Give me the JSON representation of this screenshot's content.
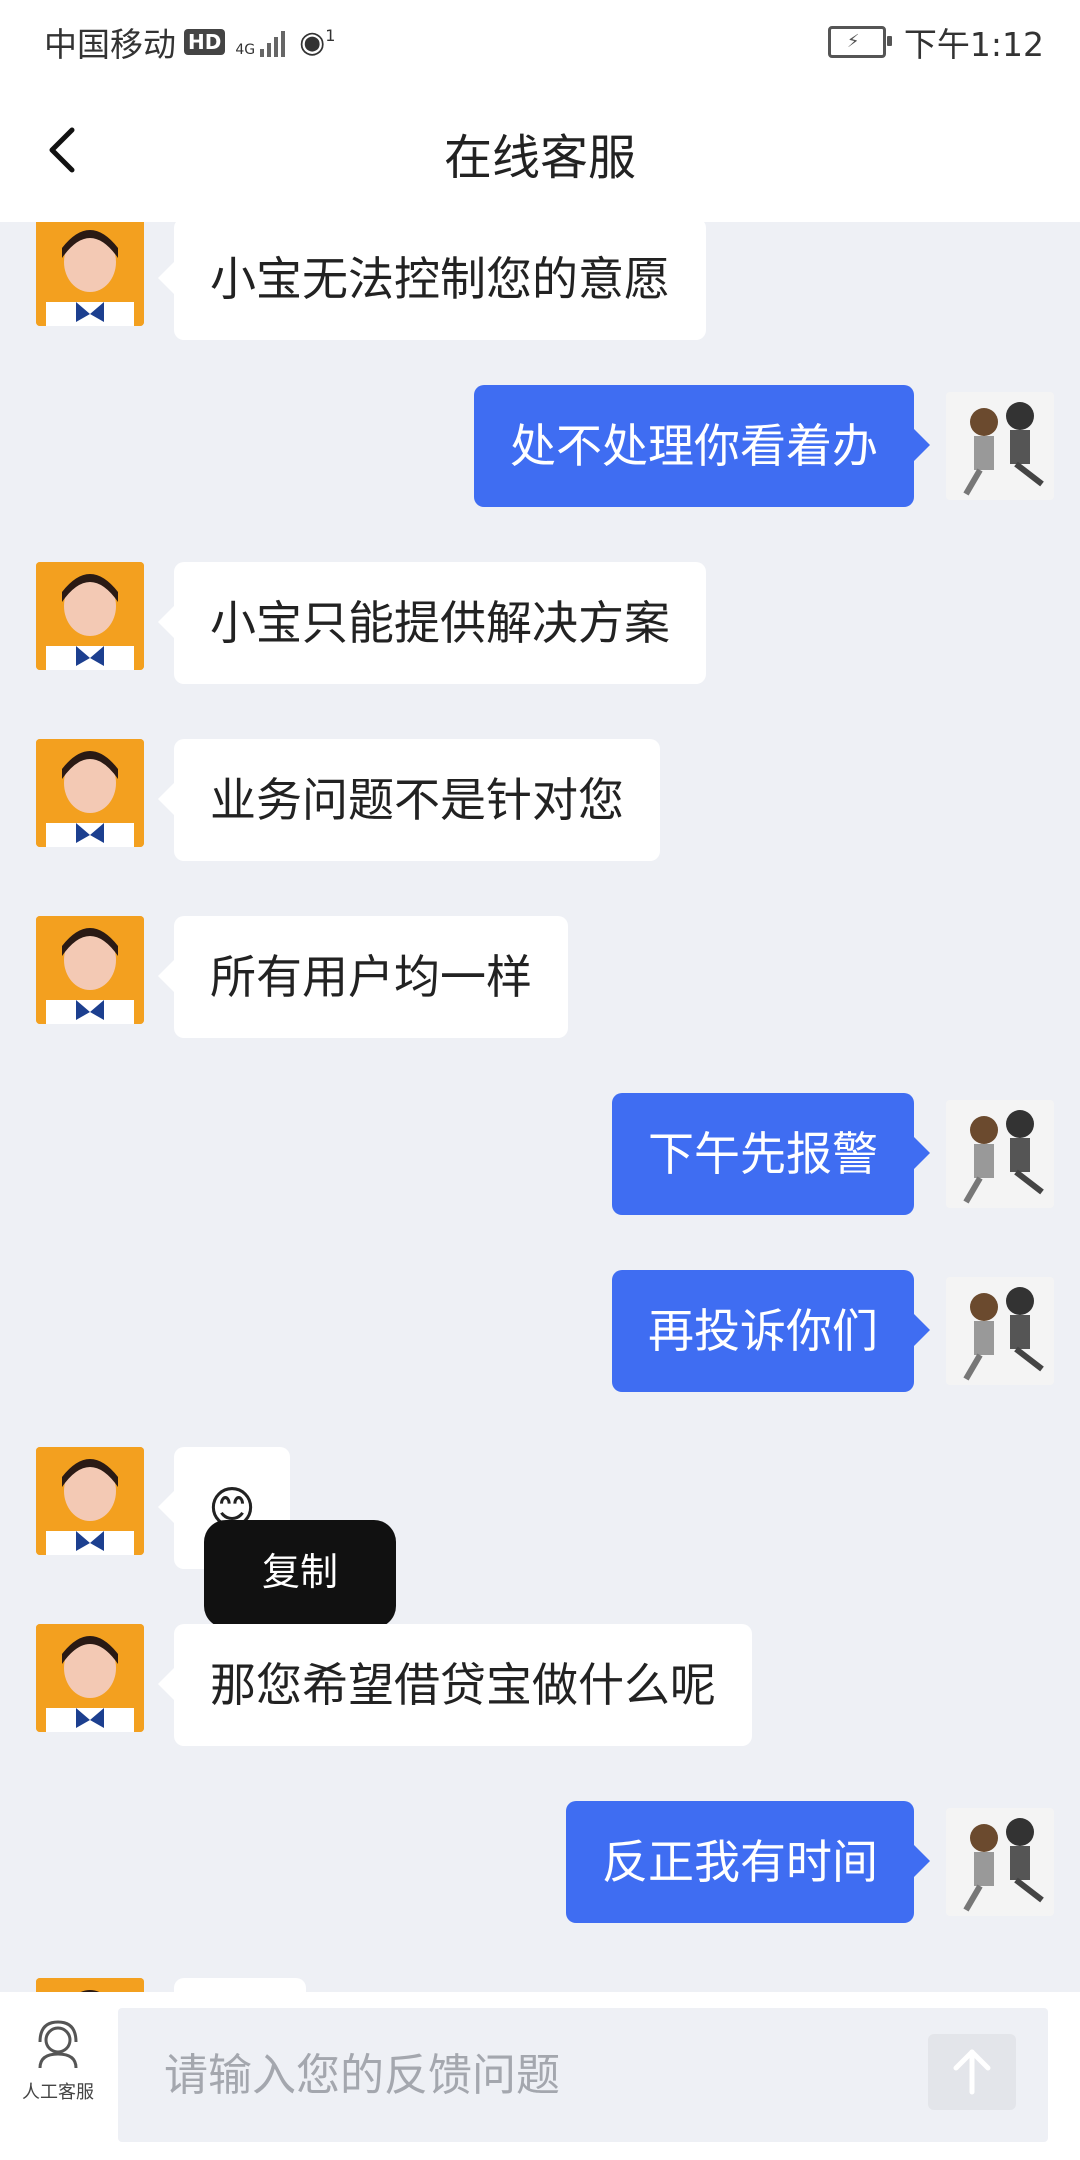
{
  "status_bar": {
    "carrier": "中国移动",
    "hd": "HD",
    "network": "4G",
    "hotspot_count": "1",
    "time": "下午1:12"
  },
  "header": {
    "title": "在线客服"
  },
  "messages": [
    {
      "side": "left",
      "text": "小宝无法控制您的意愿"
    },
    {
      "side": "right",
      "text": "处不处理你看着办"
    },
    {
      "side": "left",
      "text": "小宝只能提供解决方案"
    },
    {
      "side": "left",
      "text": "业务问题不是针对您"
    },
    {
      "side": "left",
      "text": "所有用户均一样"
    },
    {
      "side": "right",
      "text": "下午先报警"
    },
    {
      "side": "right",
      "text": "再投诉你们"
    },
    {
      "side": "left",
      "text": "😊"
    },
    {
      "side": "left",
      "text": "那您希望借贷宝做什么呢"
    },
    {
      "side": "right",
      "text": "反正我有时间"
    }
  ],
  "context_menu": {
    "copy": "复制"
  },
  "bottom_bar": {
    "agent_label": "人工客服",
    "input_placeholder": "请输入您的反馈问题"
  },
  "colors": {
    "accent": "#3f6df2",
    "background": "#eef0f5"
  }
}
